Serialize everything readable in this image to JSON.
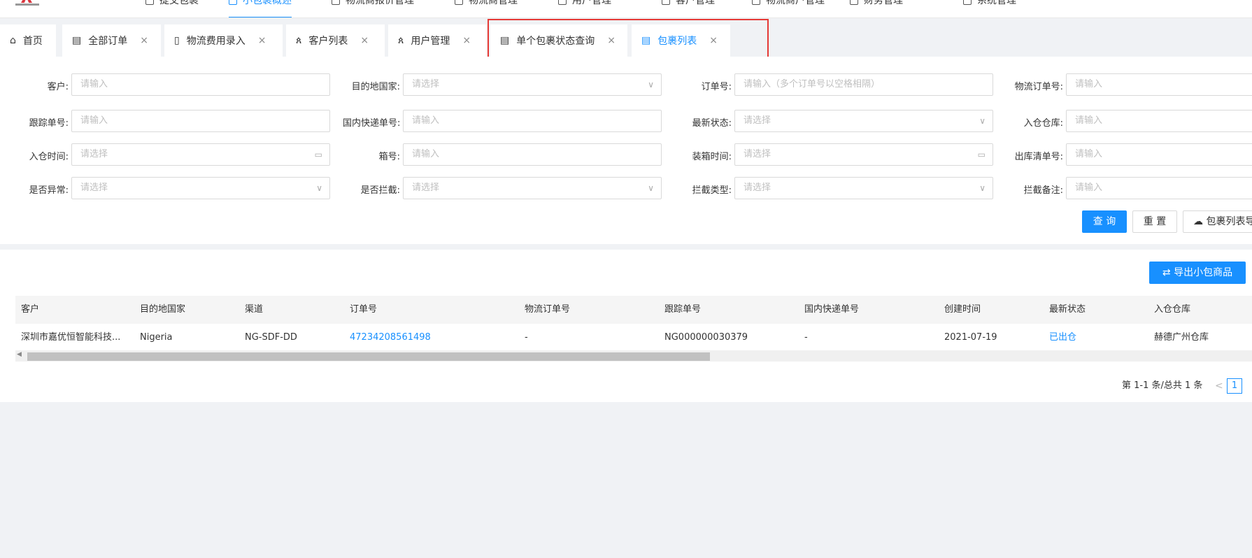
{
  "header": {
    "nav_items": [
      {
        "label": "提交包裹",
        "icon": "box-icon"
      },
      {
        "label": "小包裹概述",
        "icon": "package-icon",
        "active": true
      },
      {
        "label": "物流商报价管理",
        "icon": "list-icon"
      },
      {
        "label": "物流商管理",
        "icon": "truck-icon"
      },
      {
        "label": "用户管理",
        "icon": "user-icon"
      },
      {
        "label": "客户管理",
        "icon": "customer-icon"
      },
      {
        "label": "物流商户管理",
        "icon": "merchant-icon"
      },
      {
        "label": "财务管理",
        "icon": "finance-icon"
      },
      {
        "label": "系统管理",
        "icon": "settings-icon"
      }
    ]
  },
  "tabs": [
    {
      "label": "首页",
      "icon": "home-icon",
      "closable": false
    },
    {
      "label": "全部订单",
      "icon": "list-icon",
      "closable": true
    },
    {
      "label": "物流费用录入",
      "icon": "document-icon",
      "closable": true
    },
    {
      "label": "客户列表",
      "icon": "users-icon",
      "closable": true
    },
    {
      "label": "用户管理",
      "icon": "users-icon",
      "closable": true
    },
    {
      "label": "单个包裹状态查询",
      "icon": "document-icon",
      "closable": true
    },
    {
      "label": "包裹列表",
      "icon": "document-icon",
      "closable": true,
      "active": true
    }
  ],
  "filters": {
    "customer": {
      "label": "客户:",
      "placeholder": "请输入"
    },
    "destination": {
      "label": "目的地国家:",
      "placeholder": "请选择"
    },
    "order_no": {
      "label": "订单号:",
      "placeholder": "请输入（多个订单号以空格相隔）"
    },
    "logistics_order_no": {
      "label": "物流订单号:",
      "placeholder": "请输入"
    },
    "tracking_no": {
      "label": "跟踪单号:",
      "placeholder": "请输入"
    },
    "domestic_express_no": {
      "label": "国内快递单号:",
      "placeholder": "请输入"
    },
    "latest_status": {
      "label": "最新状态:",
      "placeholder": "请选择"
    },
    "warehouse_in": {
      "label": "入仓仓库:",
      "placeholder": "请输入"
    },
    "in_time": {
      "label": "入仓时间:",
      "placeholder": "请选择"
    },
    "box_no": {
      "label": "箱号:",
      "placeholder": "请输入"
    },
    "packing_time": {
      "label": "装箱时间:",
      "placeholder": "请选择"
    },
    "outbound_list_no": {
      "label": "出库清单号:",
      "placeholder": "请输入"
    },
    "is_abnormal": {
      "label": "是否异常:",
      "placeholder": "请选择"
    },
    "is_intercepted": {
      "label": "是否拦截:",
      "placeholder": "请选择"
    },
    "intercept_type": {
      "label": "拦截类型:",
      "placeholder": "请选择"
    },
    "intercept_note": {
      "label": "拦截备注:",
      "placeholder": "请输入"
    }
  },
  "actions": {
    "query": "查 询",
    "reset": "重 置",
    "export_list": "包裹列表导出",
    "export_small": "导出小包商品"
  },
  "table": {
    "columns": [
      "客户",
      "目的地国家",
      "渠道",
      "订单号",
      "物流订单号",
      "跟踪单号",
      "国内快递单号",
      "创建时间",
      "最新状态",
      "入仓仓库"
    ],
    "rows": [
      [
        "深圳市嘉优恒智能科技...",
        "Nigeria",
        "NG-SDF-DD",
        "47234208561498",
        "-",
        "NG000000030379",
        "-",
        "2021-07-19",
        "已出仓",
        "赫德广州仓库"
      ]
    ]
  },
  "pagination": {
    "summary": "第 1-1 条/总共 1 条",
    "current_page": "1",
    "prev": "<"
  },
  "colors": {
    "primary": "#1890ff",
    "highlight_box": "#e53935"
  }
}
